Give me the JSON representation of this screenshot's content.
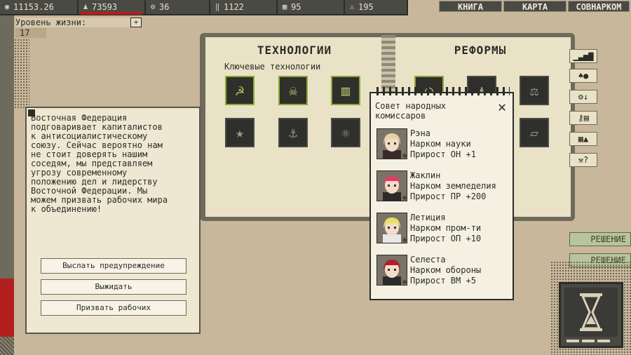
{
  "resources": {
    "money": "11153.26",
    "population": "73593",
    "industry": "36",
    "food": "1122",
    "military": "95",
    "arms": "195"
  },
  "nav": {
    "book": "КНИГА",
    "map": "КАРТА",
    "sovnarkom": "СОВНАРКОМ"
  },
  "life": {
    "label": "Уровень жизни:",
    "plus": "+",
    "value": "17"
  },
  "book": {
    "tech_title": "ТЕХНОЛОГИИ",
    "tech_subtitle": "Ключевые технологии",
    "reforms_title": "РЕФОРМЫ"
  },
  "event": {
    "text": "Восточная Федерация\nподговаривает капиталистов\nк антисоциалистическому\nсоюзу. Сейчас вероятно нам\nне стоит доверять нашим\nсоседям, мы представляем\nугрозу современному\nположению дел и лидерству\nВосточной Федерации. Мы\nможем призвать рабочих мира\nк объединению!",
    "buttons": [
      "Выслать предупреждение",
      "Выжидать",
      "Призвать рабочих"
    ]
  },
  "popup": {
    "title": "Совет народных\nкомиссаров",
    "close": "✕",
    "commissars": [
      {
        "name": "Рэна",
        "role": "Нарком науки",
        "bonus": "Прирост ОН +1",
        "hair": "#e8d0a0",
        "accent": "#3a2a2a"
      },
      {
        "name": "Жаклин",
        "role": "Нарком земледелия",
        "bonus": "Прирост ПР +200",
        "hair": "#d8406a",
        "accent": "#2a2a2a"
      },
      {
        "name": "Летиция",
        "role": "Нарком пром-ти",
        "bonus": "Прирост ОП +10",
        "hair": "#e8e060",
        "accent": "#e8e8e8"
      },
      {
        "name": "Селеста",
        "role": "Нарком обороны",
        "bonus": "Прирост ВМ +5",
        "hair": "#b01e28",
        "accent": "#2a2a2a"
      }
    ]
  },
  "decisions": [
    "РЕШЕНИЕ",
    "РЕШЕНИЕ"
  ],
  "icons": {
    "money": "coin-icon",
    "population": "people-icon",
    "industry": "gear-icon",
    "food": "wheat-icon",
    "military": "barracks-icon",
    "arms": "crossed-swords-icon"
  }
}
